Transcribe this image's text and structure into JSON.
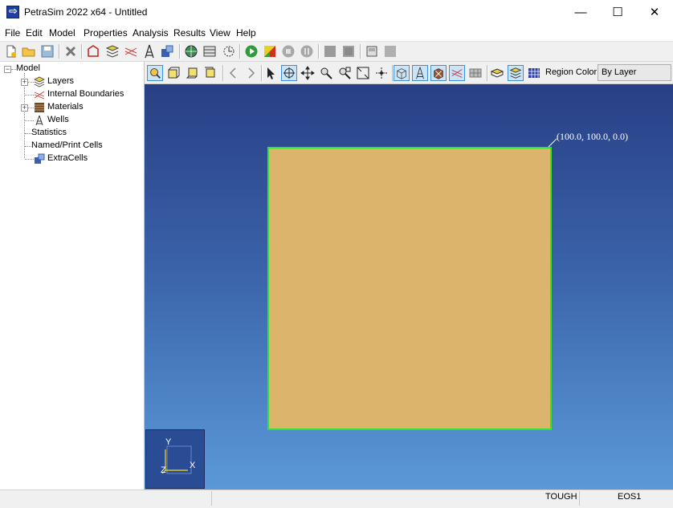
{
  "window": {
    "title": "PetraSim 2022 x64 - Untitled",
    "minimize_glyph": "—",
    "maximize_glyph": "☐",
    "close_glyph": "✕"
  },
  "menu": [
    "File",
    "Edit",
    "Model",
    "Properties",
    "Analysis",
    "Results",
    "View",
    "Help"
  ],
  "main_toolbar_icons": [
    "new-icon",
    "open-folder-icon",
    "save-icon",
    "delete-icon",
    "polygon-boundary-icon",
    "layers-icon",
    "internal-boundaries-icon",
    "well-icon",
    "extra-cells-icon",
    "globe-icon",
    "mesh-icon",
    "clock-icon",
    "run-icon",
    "colormap-icon",
    "stop-icon",
    "pause-icon",
    "plot-3d-icon",
    "plot-2d-icon",
    "window-icon",
    "output-icon"
  ],
  "tree": {
    "root": "Model",
    "items": [
      {
        "label": "Layers",
        "icon": "layers-icon",
        "expandable": true
      },
      {
        "label": "Internal Boundaries",
        "icon": "internal-boundaries-icon",
        "expandable": false
      },
      {
        "label": "Materials",
        "icon": "materials-icon",
        "expandable": true
      },
      {
        "label": "Wells",
        "icon": "well-icon",
        "expandable": false
      },
      {
        "label": "Statistics",
        "icon": "",
        "expandable": false
      },
      {
        "label": "Named/Print Cells",
        "icon": "",
        "expandable": false
      },
      {
        "label": "ExtraCells",
        "icon": "extra-cells-icon",
        "expandable": false
      }
    ]
  },
  "view_toolbar": {
    "region_color_label": "Region Color:",
    "region_color_value": "By Layer"
  },
  "viewport": {
    "corner_label": "(100.0,  100.0,  0.0)",
    "axis_y": "Y",
    "axis_x": "X",
    "axis_z": "Z",
    "model_fill": "#dcb46c",
    "model_border": "#2ee52e"
  },
  "status": {
    "simulator": "TOUGH",
    "eos": "EOS1"
  }
}
